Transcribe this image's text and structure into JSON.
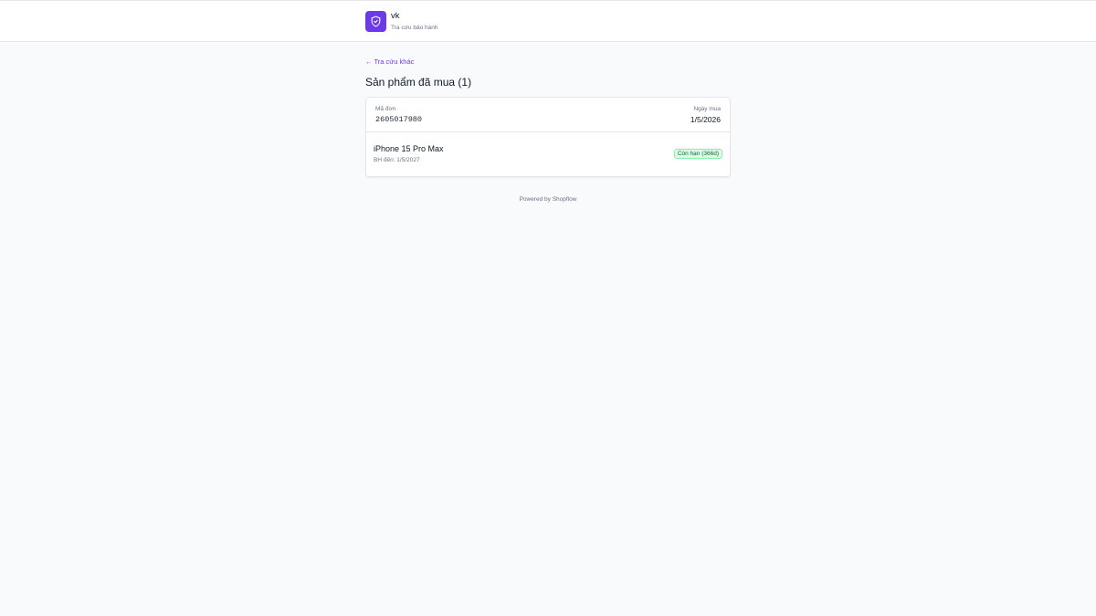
{
  "brand": {
    "name": "vk",
    "subtitle": "Tra cứu bảo hành",
    "accent_color": "#6d3ae8",
    "logo_icon": "shield-check-icon"
  },
  "nav": {
    "back_link": "← Tra cứu khác"
  },
  "main": {
    "title": "Sản phẩm đã mua (1)"
  },
  "order": {
    "id_label": "Mã đơn",
    "id": "2605017980",
    "date_label": "Ngày mua",
    "date": "1/5/2026",
    "items": [
      {
        "name": "iPhone 15 Pro Max",
        "warranty": "BH đến: 1/5/2027",
        "status": "Còn hạn (366d)",
        "status_color": "#166534"
      }
    ]
  },
  "footer": {
    "text": "Powered by Shopflow"
  }
}
